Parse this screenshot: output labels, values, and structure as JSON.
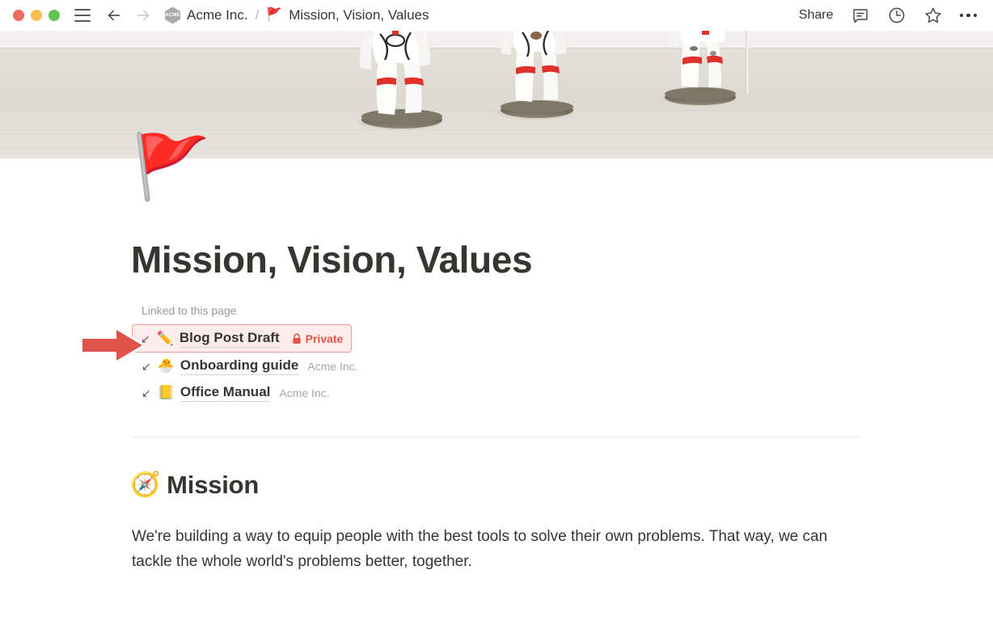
{
  "window": {
    "traffic_lights": [
      "close",
      "minimize",
      "maximize"
    ],
    "colors": {
      "close": "#ed6a5e",
      "minimize": "#f5bf4f",
      "maximize": "#61c554",
      "accent_red": "#e2564a",
      "highlight_bg": "#fdecec",
      "highlight_border": "#ef9a9a",
      "text": "#37352f",
      "muted": "#9b9a97"
    }
  },
  "titlebar": {
    "menu_icon": "hamburger-icon",
    "back_icon": "arrow-left-icon",
    "forward_icon": "arrow-right-icon",
    "breadcrumb": {
      "workspace_logo_text": "ACME",
      "workspace": "Acme Inc.",
      "separator": "/",
      "page_flag": "🚩",
      "page": "Mission, Vision, Values"
    },
    "share_label": "Share",
    "comment_icon": "comment-icon",
    "history_icon": "clock-history-icon",
    "favorite_icon": "star-icon",
    "more_icon": "more-options-icon"
  },
  "cover": {
    "description": "astronaut-figurines-photo"
  },
  "page": {
    "icon": "🚩",
    "title": "Mission, Vision, Values"
  },
  "backlinks": {
    "label": "Linked to this page",
    "items": [
      {
        "link_arrow": "↙",
        "emoji": "✏️",
        "name": "Blog Post Draft",
        "badge": "Private",
        "badge_icon": "lock-icon",
        "parent": "",
        "highlighted": true
      },
      {
        "link_arrow": "↙",
        "emoji": "🐣",
        "name": "Onboarding guide",
        "badge": "",
        "parent": "Acme Inc.",
        "highlighted": false
      },
      {
        "link_arrow": "↙",
        "emoji": "📒",
        "name": "Office Manual",
        "badge": "",
        "parent": "Acme Inc.",
        "highlighted": false
      }
    ]
  },
  "annotation": {
    "arrow": "red-right-arrow-annotation"
  },
  "mission": {
    "emoji": "🧭",
    "heading": "Mission",
    "body": "We're building a way to equip people with the best tools to solve their own problems. That way, we can tackle the whole world's problems better, together."
  }
}
